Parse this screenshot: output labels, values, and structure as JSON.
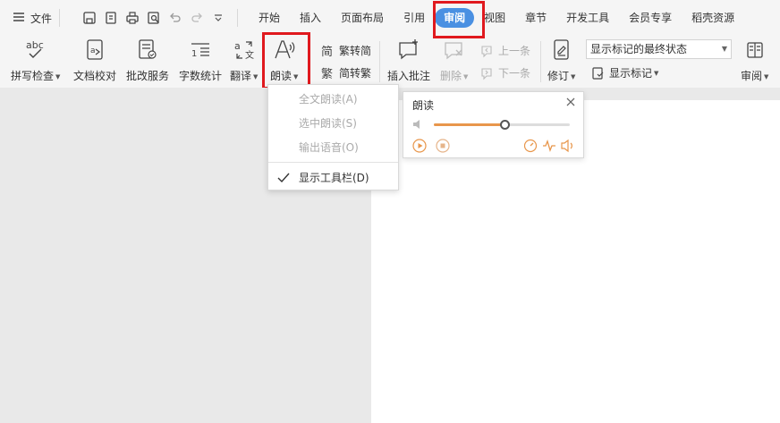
{
  "menubar": {
    "file_label": "文件",
    "tabs": [
      "开始",
      "插入",
      "页面布局",
      "引用",
      "审阅",
      "视图",
      "章节",
      "开发工具",
      "会员专享",
      "稻壳资源"
    ],
    "active_tab": "审阅"
  },
  "ribbon": {
    "spell_check": "拼写检查",
    "doc_proof": "文档校对",
    "review_service": "批改服务",
    "word_count": "字数统计",
    "translate": "翻译",
    "read_aloud": "朗读",
    "trad_to_simp": "繁转简",
    "simp_to_trad": "简转繁",
    "insert_comment": "插入批注",
    "delete": "删除",
    "prev": "上一条",
    "next": "下一条",
    "track_changes": "修订",
    "markup_select": "显示标记的最终状态",
    "show_markup": "显示标记",
    "review": "审阅"
  },
  "dropdown": {
    "items": [
      "全文朗读(A)",
      "选中朗读(S)",
      "输出语音(O)",
      "显示工具栏(D)"
    ]
  },
  "reader_panel": {
    "title": "朗读",
    "volume_level": 0.52
  },
  "colors": {
    "accent_blue": "#4a90e2",
    "highlight_red": "#e0191e",
    "progress_orange": "#e8964b"
  }
}
